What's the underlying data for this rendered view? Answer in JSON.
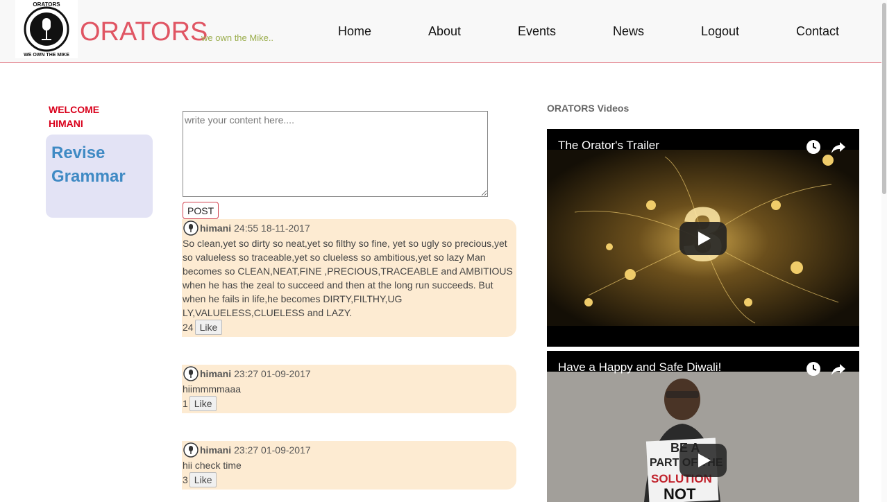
{
  "header": {
    "brand": "ORATORS",
    "tagline": "we own the Mike..",
    "logo_text_top": "ORATORS",
    "logo_text_bottom": "WE OWN THE MIKE",
    "nav": [
      "Home",
      "About",
      "Events",
      "News",
      "Logout",
      "Contact"
    ]
  },
  "sidebar": {
    "welcome_line1": "WELCOME",
    "welcome_line2": "HIMANI",
    "revise_line1": "Revise",
    "revise_line2": "Grammar"
  },
  "composer": {
    "placeholder": "write your content here....",
    "post_label": "POST"
  },
  "posts": [
    {
      "user": "himani",
      "time": "24:55 18-11-2017",
      "lines": [
        "So clean,yet so dirty so neat,yet so filthy so fine, yet so ugly so precious,yet",
        "so valueless so traceable,yet so clueless so ambitious,yet so lazy Man",
        "becomes so CLEAN,NEAT,FINE ,PRECIOUS,TRACEABLE and AMBITIOUS",
        "when he has the zeal to succeed and then at the long run succeeds. But",
        "when he fails in life,he becomes DIRTY,FILTHY,UG",
        "LY,VALUELESS,CLUELESS and LAZY."
      ],
      "likes": "24",
      "like_label": "Like"
    },
    {
      "user": "himani",
      "time": "23:27 01-09-2017",
      "lines": [
        "hiimmmmaaa"
      ],
      "likes": "1",
      "like_label": "Like"
    },
    {
      "user": "himani",
      "time": "23:27 01-09-2017",
      "lines": [
        "hii check time"
      ],
      "likes": "3",
      "like_label": "Like"
    }
  ],
  "videos": {
    "title": "ORATORS Videos",
    "items": [
      {
        "title": "The Orator's Trailer"
      },
      {
        "title": "Have a Happy and Safe Diwali!",
        "sign_line1": "BE A",
        "sign_line2": "PART OF THE",
        "sign_line3": "SOLUTION",
        "sign_line4": "NOT"
      }
    ]
  },
  "colors": {
    "brand": "#e05563",
    "tagline": "#9aad4c",
    "welcome": "#d9001b",
    "post_bg": "#fdebd2",
    "revise_bg": "#e3e3f5"
  }
}
